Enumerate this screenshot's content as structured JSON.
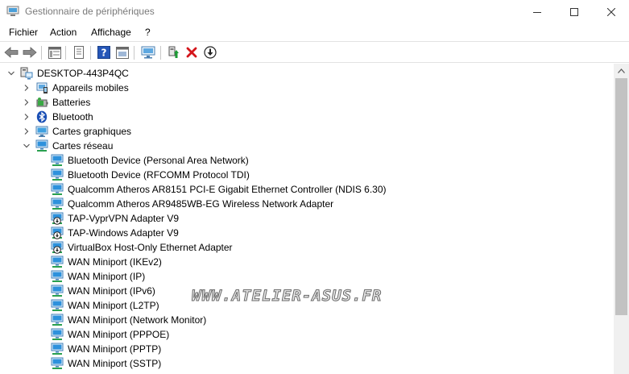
{
  "window": {
    "title": "Gestionnaire de périphériques",
    "controls": {
      "minimize": "minimize-icon",
      "maximize": "maximize-icon",
      "close": "close-icon"
    }
  },
  "menu": {
    "items": [
      "Fichier",
      "Action",
      "Affichage",
      "?"
    ]
  },
  "toolbar": {
    "buttons": [
      "back-arrow-icon",
      "forward-arrow-icon",
      "properties-icon",
      "update-driver-icon",
      "help-icon",
      "action-view-icon",
      "monitor-icon",
      "enable-device-icon",
      "uninstall-x-icon",
      "download-circle-icon"
    ]
  },
  "tree": {
    "root": {
      "label": "DESKTOP-443P4QC",
      "icon": "computer-icon",
      "expanded": true
    },
    "categories": [
      {
        "label": "Appareils mobiles",
        "icon": "mobile-devices-icon",
        "expanded": false
      },
      {
        "label": "Batteries",
        "icon": "battery-icon",
        "expanded": false
      },
      {
        "label": "Bluetooth",
        "icon": "bluetooth-icon",
        "expanded": false
      },
      {
        "label": "Cartes graphiques",
        "icon": "display-adapter-icon",
        "expanded": false
      },
      {
        "label": "Cartes réseau",
        "icon": "network-adapter-icon",
        "expanded": true
      }
    ],
    "network_adapters": [
      {
        "label": "Bluetooth Device (Personal Area Network)",
        "icon": "network-adapter-icon"
      },
      {
        "label": "Bluetooth Device (RFCOMM Protocol TDI)",
        "icon": "network-adapter-icon"
      },
      {
        "label": "Qualcomm Atheros AR8151 PCI-E Gigabit Ethernet Controller (NDIS 6.30)",
        "icon": "network-adapter-icon"
      },
      {
        "label": "Qualcomm Atheros AR9485WB-EG Wireless Network Adapter",
        "icon": "network-adapter-icon"
      },
      {
        "label": "TAP-VyprVPN Adapter V9",
        "icon": "disabled-adapter-icon"
      },
      {
        "label": "TAP-Windows Adapter V9",
        "icon": "disabled-adapter-icon"
      },
      {
        "label": "VirtualBox Host-Only Ethernet Adapter",
        "icon": "disabled-adapter-icon"
      },
      {
        "label": "WAN Miniport (IKEv2)",
        "icon": "network-adapter-icon"
      },
      {
        "label": "WAN Miniport (IP)",
        "icon": "network-adapter-icon"
      },
      {
        "label": "WAN Miniport (IPv6)",
        "icon": "network-adapter-icon"
      },
      {
        "label": "WAN Miniport (L2TP)",
        "icon": "network-adapter-icon"
      },
      {
        "label": "WAN Miniport (Network Monitor)",
        "icon": "network-adapter-icon"
      },
      {
        "label": "WAN Miniport (PPPOE)",
        "icon": "network-adapter-icon"
      },
      {
        "label": "WAN Miniport (PPTP)",
        "icon": "network-adapter-icon"
      },
      {
        "label": "WAN Miniport (SSTP)",
        "icon": "network-adapter-icon"
      }
    ]
  },
  "watermark": "WWW.ATELIER-ASUS.FR",
  "colors": {
    "title_text": "#7a7a7a",
    "adapter_blue": "#1e8bd6",
    "uninstall_red": "#d4151b",
    "scroll_thumb": "#c2c2c2"
  }
}
